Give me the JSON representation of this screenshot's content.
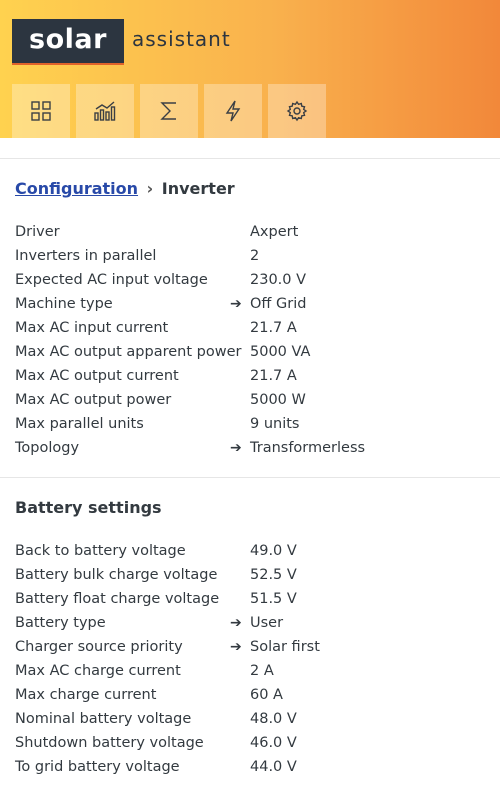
{
  "header": {
    "logo_box": "solar",
    "logo_text": "assistant",
    "nav": [
      {
        "icon": "dashboard-icon"
      },
      {
        "icon": "chart-icon"
      },
      {
        "icon": "sigma-icon"
      },
      {
        "icon": "lightning-icon"
      },
      {
        "icon": "gear-icon"
      }
    ]
  },
  "breadcrumb": {
    "link": "Configuration",
    "separator": "›",
    "current": "Inverter"
  },
  "inverter": [
    {
      "label": "Driver",
      "value": "Axpert",
      "arrow": ""
    },
    {
      "label": "Inverters in parallel",
      "value": "2",
      "arrow": ""
    },
    {
      "label": "Expected AC input voltage",
      "value": "230.0 V",
      "arrow": ""
    },
    {
      "label": "Machine type",
      "value": "Off Grid",
      "arrow": "➔"
    },
    {
      "label": "Max AC input current",
      "value": "21.7 A",
      "arrow": ""
    },
    {
      "label": "Max AC output apparent power",
      "value": "5000 VA",
      "arrow": ""
    },
    {
      "label": "Max AC output current",
      "value": "21.7 A",
      "arrow": ""
    },
    {
      "label": "Max AC output power",
      "value": "5000 W",
      "arrow": ""
    },
    {
      "label": "Max parallel units",
      "value": "9 units",
      "arrow": ""
    },
    {
      "label": "Topology",
      "value": "Transformerless",
      "arrow": "➔"
    }
  ],
  "battery": {
    "title": "Battery settings",
    "rows": [
      {
        "label": "Back to battery voltage",
        "value": "49.0 V",
        "arrow": ""
      },
      {
        "label": "Battery bulk charge voltage",
        "value": "52.5 V",
        "arrow": ""
      },
      {
        "label": "Battery float charge voltage",
        "value": "51.5 V",
        "arrow": ""
      },
      {
        "label": "Battery type",
        "value": "User",
        "arrow": "➔"
      },
      {
        "label": "Charger source priority",
        "value": "Solar first",
        "arrow": "➔"
      },
      {
        "label": "Max AC charge current",
        "value": "2 A",
        "arrow": ""
      },
      {
        "label": "Max charge current",
        "value": "60 A",
        "arrow": ""
      },
      {
        "label": "Nominal battery voltage",
        "value": "48.0 V",
        "arrow": ""
      },
      {
        "label": "Shutdown battery voltage",
        "value": "46.0 V",
        "arrow": ""
      },
      {
        "label": "To grid battery voltage",
        "value": "44.0 V",
        "arrow": ""
      }
    ]
  }
}
